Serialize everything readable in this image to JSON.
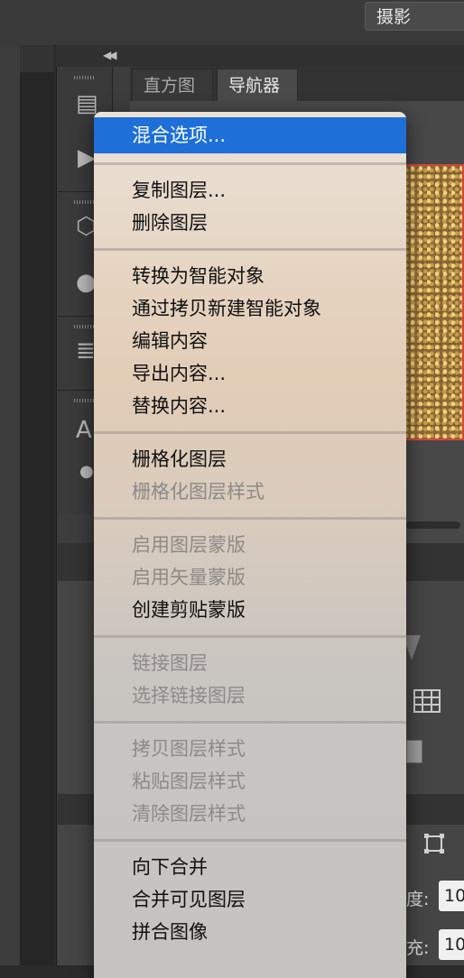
{
  "workspace": {
    "label": "摄影"
  },
  "panels": {
    "tabs": [
      {
        "label": "直方图",
        "active": false
      },
      {
        "label": "导航器",
        "active": true
      }
    ],
    "layer_options": {
      "opacity_label": "度:",
      "opacity_value": "10",
      "fill_label": "充:",
      "fill_value": "10"
    }
  },
  "context_menu": {
    "highlight_color": "#1e6fd8",
    "groups": [
      [
        {
          "label": "混合选项...",
          "enabled": true,
          "highlighted": true
        }
      ],
      [
        {
          "label": "复制图层...",
          "enabled": true
        },
        {
          "label": "删除图层",
          "enabled": true
        }
      ],
      [
        {
          "label": "转换为智能对象",
          "enabled": true
        },
        {
          "label": "通过拷贝新建智能对象",
          "enabled": true
        },
        {
          "label": "编辑内容",
          "enabled": true
        },
        {
          "label": "导出内容...",
          "enabled": true
        },
        {
          "label": "替换内容...",
          "enabled": true
        }
      ],
      [
        {
          "label": "栅格化图层",
          "enabled": true
        },
        {
          "label": "栅格化图层样式",
          "enabled": false
        }
      ],
      [
        {
          "label": "启用图层蒙版",
          "enabled": false
        },
        {
          "label": "启用矢量蒙版",
          "enabled": false
        },
        {
          "label": "创建剪贴蒙版",
          "enabled": true
        }
      ],
      [
        {
          "label": "链接图层",
          "enabled": false
        },
        {
          "label": "选择链接图层",
          "enabled": false
        }
      ],
      [
        {
          "label": "拷贝图层样式",
          "enabled": false
        },
        {
          "label": "粘贴图层样式",
          "enabled": false
        },
        {
          "label": "清除图层样式",
          "enabled": false
        }
      ],
      [
        {
          "label": "向下合并",
          "enabled": true
        },
        {
          "label": "合并可见图层",
          "enabled": true
        },
        {
          "label": "拼合图像",
          "enabled": true
        }
      ]
    ]
  }
}
